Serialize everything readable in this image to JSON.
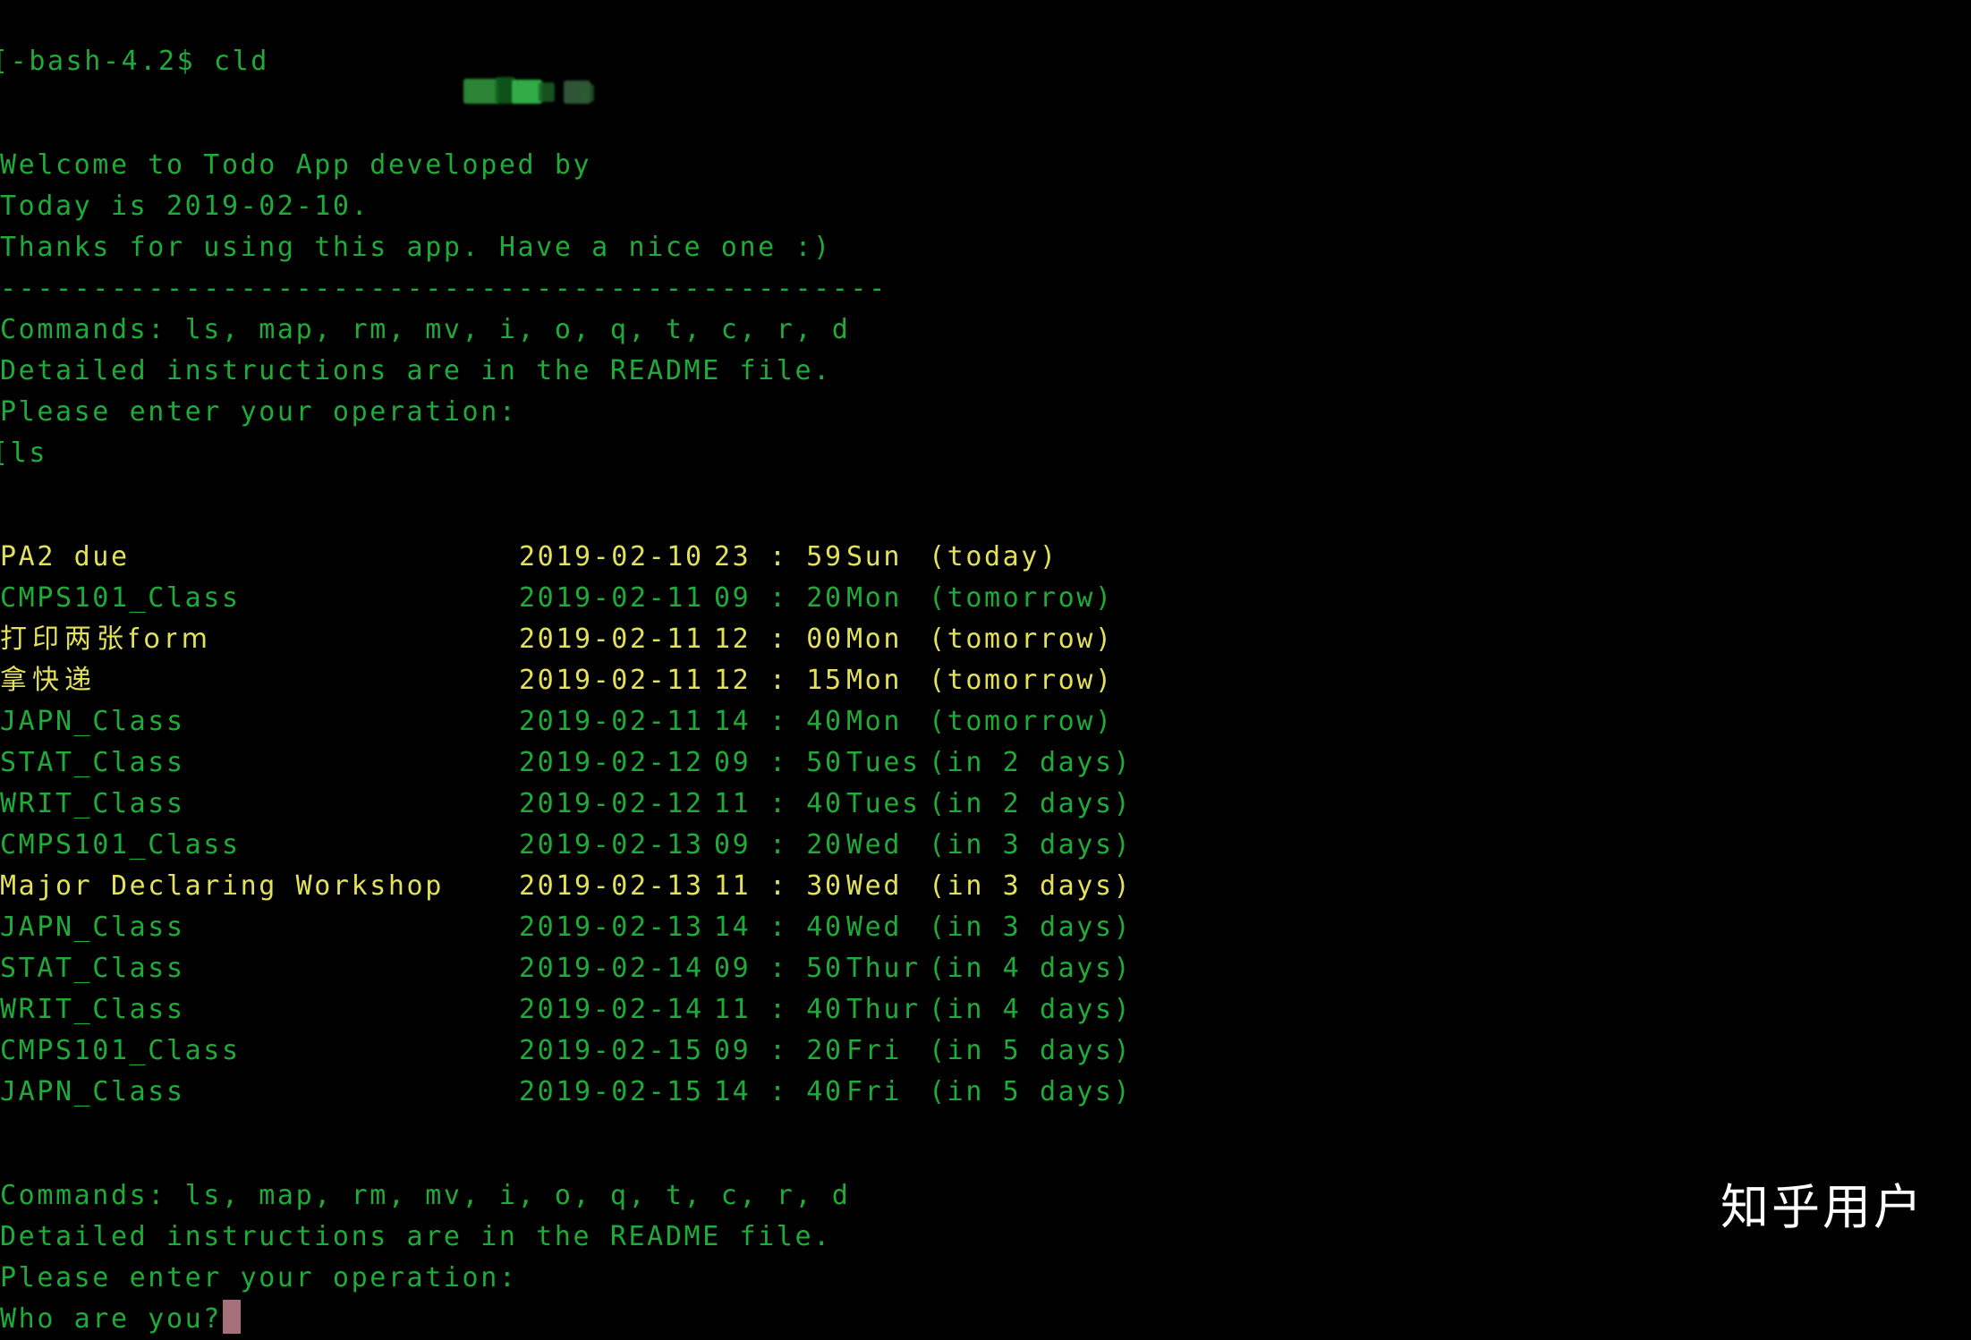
{
  "terminal": {
    "prompt_line": "[-bash-4.2$ cld",
    "welcome_prefix": "Welcome to Todo App developed by ",
    "author_redacted": "",
    "today_line": "Today is 2019-02-10.",
    "thanks_line": "Thanks for using this app. Have a nice one :)",
    "separator": "------------------------------------------------",
    "commands_line": "Commands: ls, map, rm, mv, i, o, q, t, c, r, d",
    "instructions_line": "Detailed instructions are in the README file.",
    "operation_prompt": "Please enter your operation:",
    "typed_command": "[ls",
    "commands_line_2": "Commands: ls, map, rm, mv, i, o, q, t, c, r, d",
    "instructions_line_2": "Detailed instructions are in the README file.",
    "operation_prompt_2": "Please enter your operation:",
    "who_are_you": "Who are you?"
  },
  "colors": {
    "background": "#000000",
    "green": "#1faa3a",
    "yellow": "#e3e05a",
    "cursor": "#a5707a",
    "watermark": "#ffffff"
  },
  "tasks": [
    {
      "title": "PA2 due",
      "date": "2019-02-10",
      "time": "23 : 59",
      "dow": "Sun",
      "relative": "(today)",
      "color": "yellow"
    },
    {
      "title": "CMPS101_Class",
      "date": "2019-02-11",
      "time": "09 : 20",
      "dow": "Mon",
      "relative": "(tomorrow)",
      "color": "green"
    },
    {
      "title": "打印两张form",
      "date": "2019-02-11",
      "time": "12 : 00",
      "dow": "Mon",
      "relative": "(tomorrow)",
      "color": "yellow"
    },
    {
      "title": "拿快递",
      "date": "2019-02-11",
      "time": "12 : 15",
      "dow": "Mon",
      "relative": "(tomorrow)",
      "color": "yellow"
    },
    {
      "title": "JAPN_Class",
      "date": "2019-02-11",
      "time": "14 : 40",
      "dow": "Mon",
      "relative": "(tomorrow)",
      "color": "green"
    },
    {
      "title": "STAT_Class",
      "date": "2019-02-12",
      "time": "09 : 50",
      "dow": "Tues",
      "relative": "(in 2 days)",
      "color": "green"
    },
    {
      "title": "WRIT_Class",
      "date": "2019-02-12",
      "time": "11 : 40",
      "dow": "Tues",
      "relative": "(in 2 days)",
      "color": "green"
    },
    {
      "title": "CMPS101_Class",
      "date": "2019-02-13",
      "time": "09 : 20",
      "dow": "Wed",
      "relative": "(in 3 days)",
      "color": "green"
    },
    {
      "title": "Major Declaring Workshop",
      "date": "2019-02-13",
      "time": "11 : 30",
      "dow": "Wed",
      "relative": "(in 3 days)",
      "color": "yellow"
    },
    {
      "title": "JAPN_Class",
      "date": "2019-02-13",
      "time": "14 : 40",
      "dow": "Wed",
      "relative": "(in 3 days)",
      "color": "green"
    },
    {
      "title": "STAT_Class",
      "date": "2019-02-14",
      "time": "09 : 50",
      "dow": "Thur",
      "relative": "(in 4 days)",
      "color": "green"
    },
    {
      "title": "WRIT_Class",
      "date": "2019-02-14",
      "time": "11 : 40",
      "dow": "Thur",
      "relative": "(in 4 days)",
      "color": "green"
    },
    {
      "title": "CMPS101_Class",
      "date": "2019-02-15",
      "time": "09 : 20",
      "dow": "Fri",
      "relative": "(in 5 days)",
      "color": "green"
    },
    {
      "title": "JAPN_Class",
      "date": "2019-02-15",
      "time": "14 : 40",
      "dow": "Fri",
      "relative": "(in 5 days)",
      "color": "green"
    }
  ],
  "watermark": {
    "text": "知乎用户"
  }
}
